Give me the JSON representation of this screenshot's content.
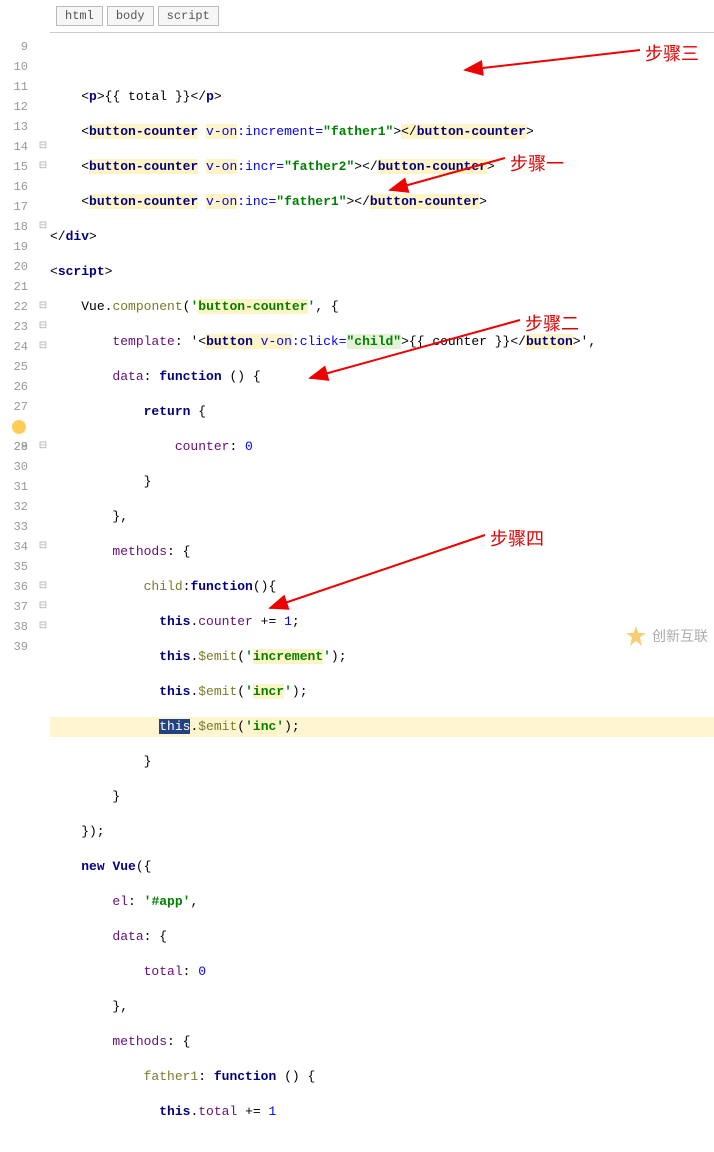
{
  "breadcrumb": {
    "items": [
      "html",
      "body",
      "script"
    ]
  },
  "gutter": {
    "start": 9,
    "end": 39,
    "bulb_line": 28
  },
  "code": {
    "l9": {},
    "l10": {
      "tag": "p",
      "inner": "{{ total }}"
    },
    "l11": {
      "tag_open": "button-counter",
      "attr": "v-on",
      "attr_after": ":increment=",
      "val": "\"father1\"",
      "tag_close": "button-counter"
    },
    "l12": {
      "tag_open": "button-counter",
      "attr": "v-on",
      "attr_after": ":incr=",
      "val": "\"father2\"",
      "tag_close": "button-counter"
    },
    "l13": {
      "tag_open": "button-counter",
      "attr": "v-on",
      "attr_after": ":inc=",
      "val": "\"father1\"",
      "tag_close": "button-counter"
    },
    "l14": {
      "close": "div"
    },
    "l15": {
      "open": "script"
    },
    "l16": {
      "vue": "Vue.",
      "comp": "component",
      "arg": "button-counter"
    },
    "l17": {
      "prop": "template",
      "pre": ": '<",
      "btn": "button",
      "von": " v-on",
      "click": ":click=",
      "val": "\"child\"",
      "inner": ">{{ counter }}</",
      "btn2": "button",
      "post": ">',"
    },
    "l18": {
      "prop": "data",
      "kw": "function"
    },
    "l19": {
      "kw": "return"
    },
    "l20": {
      "prop": "counter",
      "num": "0"
    },
    "l23": {
      "prop": "methods"
    },
    "l24": {
      "prop": "child",
      "kw": "function"
    },
    "l25": {
      "this": "this",
      "prop": "counter",
      "op": " += ",
      "num": "1"
    },
    "l26": {
      "this": "this",
      "fn": "$emit",
      "arg": "increment"
    },
    "l27": {
      "this": "this",
      "fn": "$emit",
      "arg": "incr"
    },
    "l28": {
      "this": "this",
      "fn": "$emit",
      "arg": "inc"
    },
    "l32": {
      "kw1": "new",
      "kw2": "Vue"
    },
    "l33": {
      "prop": "el",
      "val": "#app"
    },
    "l34": {
      "prop": "data"
    },
    "l35": {
      "prop": "total",
      "num": "0"
    },
    "l37": {
      "prop": "methods"
    },
    "l38": {
      "prop": "father1",
      "kw": "function"
    },
    "l39": {
      "this": "this",
      "prop": "total",
      "op": " += ",
      "num": "1"
    }
  },
  "annotations": {
    "step1": "步骤一",
    "step2": "步骤二",
    "step3": "步骤三",
    "step4": "步骤四"
  },
  "watermark": {
    "text": "创新互联"
  }
}
